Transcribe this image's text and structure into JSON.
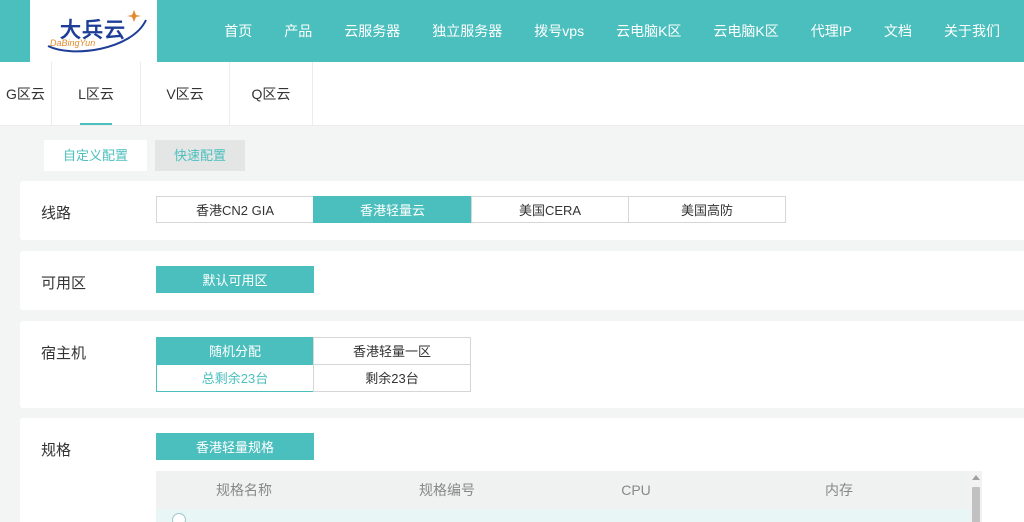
{
  "brand": {
    "logo_text": "大兵云",
    "logo_sub": "DaBingYun"
  },
  "nav": {
    "items": [
      {
        "label": "首页"
      },
      {
        "label": "产品"
      },
      {
        "label": "云服务器"
      },
      {
        "label": "独立服务器"
      },
      {
        "label": "拨号vps"
      },
      {
        "label": "云电脑K区"
      },
      {
        "label": "云电脑K区"
      },
      {
        "label": "代理IP"
      },
      {
        "label": "文档"
      },
      {
        "label": "关于我们"
      }
    ]
  },
  "zone_tabs": {
    "active": "L区云",
    "items": [
      {
        "label": "G区云"
      },
      {
        "label": "L区云"
      },
      {
        "label": "V区云"
      },
      {
        "label": "Q区云"
      }
    ]
  },
  "config_mode": {
    "custom": "自定义配置",
    "quick": "快速配置",
    "active": "自定义配置"
  },
  "line": {
    "label": "线路",
    "options": [
      {
        "label": "香港CN2 GIA"
      },
      {
        "label": "香港轻量云"
      },
      {
        "label": "美国CERA"
      },
      {
        "label": "美国高防"
      }
    ],
    "selected": "香港轻量云"
  },
  "zone": {
    "label": "可用区",
    "options": [
      {
        "label": "默认可用区"
      }
    ],
    "selected": "默认可用区"
  },
  "host": {
    "label": "宿主机",
    "options": [
      {
        "label": "随机分配",
        "sub": "总剩余23台"
      },
      {
        "label": "香港轻量一区",
        "sub": "剩余23台"
      }
    ],
    "selected": "随机分配"
  },
  "spec": {
    "label": "规格",
    "group": "香港轻量规格",
    "columns": [
      "规格名称",
      "规格编号",
      "CPU",
      "内存"
    ]
  },
  "colors": {
    "brand": "#4bbfbe",
    "logo": "#1d3d97",
    "logo_accent": "#e38b2c"
  }
}
